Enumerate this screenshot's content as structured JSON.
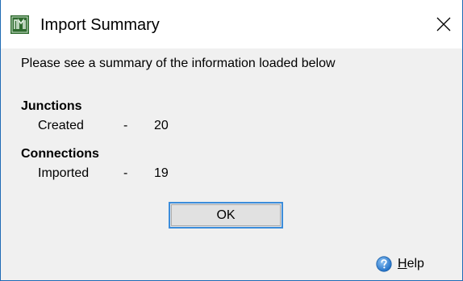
{
  "window": {
    "title": "Import Summary",
    "accent_color": "#1f6bb5"
  },
  "content": {
    "intro": "Please see a summary of the information loaded below",
    "sections": [
      {
        "heading": "Junctions",
        "label": "Created",
        "separator": "-",
        "value": "20"
      },
      {
        "heading": "Connections",
        "label": "Imported",
        "separator": "-",
        "value": "19"
      }
    ]
  },
  "buttons": {
    "ok_label": "OK",
    "help_accel": "H",
    "help_rest": "elp"
  },
  "icons": {
    "app": "app-logo-icon",
    "close": "close-icon",
    "help": "help-icon"
  }
}
